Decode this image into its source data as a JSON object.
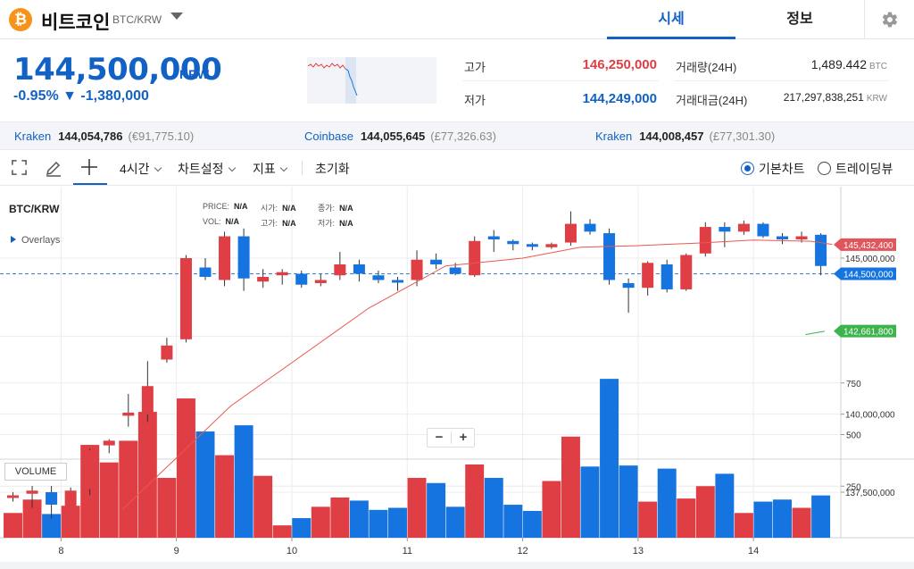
{
  "header": {
    "coin_symbol": "₿",
    "coin_name": "비트코인",
    "pair": "BTC/KRW",
    "tabs": [
      {
        "label": "시세",
        "active": true
      },
      {
        "label": "정보",
        "active": false
      }
    ],
    "settings_icon": "gear-icon"
  },
  "ticker": {
    "price": "144,500,000",
    "unit": "KRW",
    "change": "-0.95% ▼ -1,380,000",
    "high_label": "고가",
    "high_value": "146,250,000",
    "low_label": "저가",
    "low_value": "144,249,000",
    "volume_label": "거래량(24H)",
    "volume_value": "1,489.442",
    "volume_unit": "BTC",
    "amount_label": "거래대금(24H)",
    "amount_value": "217,297,838,251",
    "amount_unit": "KRW"
  },
  "exchanges": [
    {
      "name": "Kraken",
      "price": "144,054,786",
      "sub": "(€91,775.10)"
    },
    {
      "name": "Coinbase",
      "price": "144,055,645",
      "sub": "(£77,326.63)"
    },
    {
      "name": "Kraken",
      "price": "144,008,457",
      "sub": "(£77,301.30)"
    }
  ],
  "toolbar": {
    "interval": "4시간",
    "chart_settings": "차트설정",
    "indicators": "지표",
    "reset": "초기화",
    "radio_basic": "기본차트",
    "radio_tv": "트레이딩뷰"
  },
  "chart": {
    "title": "BTC/KRW",
    "overlays": "Overlays",
    "legend": {
      "price_label": "PRICE:",
      "price_val": "N/A",
      "open_label": "시가:",
      "open_val": "N/A",
      "close_label": "종가:",
      "close_val": "N/A",
      "vol_label": "VOL:",
      "vol_val": "N/A",
      "high_label": "고가:",
      "high_val": "N/A",
      "low_label": "저가:",
      "low_val": "N/A"
    },
    "volume_label": "VOLUME",
    "zoom_minus": "−",
    "zoom_plus": "+"
  },
  "chart_data": {
    "type": "candlestick",
    "up_color": "#e03e45",
    "down_color": "#1574e0",
    "ma_color": "#e8584f",
    "price_axis_ticks": [
      {
        "value": 145000000,
        "label": "145,000,000"
      },
      {
        "value": 140000000,
        "label": "140,000,000"
      },
      {
        "value": 137500000,
        "label": "137,500,000"
      }
    ],
    "price_tags": [
      {
        "value": 145432400,
        "label": "145,432,400",
        "color": "#e0565c"
      },
      {
        "value": 144500000,
        "label": "144,500,000",
        "color": "#1574e0"
      },
      {
        "value": 142661800,
        "label": "142,661,800",
        "color": "#3cb44b"
      }
    ],
    "volume_axis_ticks": [
      {
        "value": 750,
        "label": "750"
      },
      {
        "value": 500,
        "label": "500"
      },
      {
        "value": 250,
        "label": "250"
      }
    ],
    "x_tick_labels": [
      "8",
      "9",
      "10",
      "11",
      "12",
      "13",
      "14"
    ],
    "x_tick_candle_index": [
      2.5,
      8.5,
      14.5,
      20.5,
      26.5,
      32.5,
      38.5
    ],
    "candles": [
      {
        "o": 137350000,
        "c": 137400000,
        "h": 137500000,
        "l": 137200000,
        "v": 120
      },
      {
        "o": 137450000,
        "c": 137550000,
        "h": 137700000,
        "l": 137000000,
        "v": 185
      },
      {
        "o": 137500000,
        "c": 137100000,
        "h": 137700000,
        "l": 136650000,
        "v": 115
      },
      {
        "o": 136950000,
        "c": 137550000,
        "h": 137650000,
        "l": 136950000,
        "v": 155
      },
      {
        "o": 137600000,
        "c": 138850000,
        "h": 138900000,
        "l": 137400000,
        "v": 450
      },
      {
        "o": 139000000,
        "c": 139150000,
        "h": 139200000,
        "l": 138750000,
        "v": 365
      },
      {
        "o": 139950000,
        "c": 140050000,
        "h": 140650000,
        "l": 139600000,
        "v": 470
      },
      {
        "o": 140000000,
        "c": 140900000,
        "h": 141700000,
        "l": 139750000,
        "v": 610
      },
      {
        "o": 141750000,
        "c": 142200000,
        "h": 142450000,
        "l": 141650000,
        "v": 290
      },
      {
        "o": 142400000,
        "c": 145000000,
        "h": 145100000,
        "l": 142300000,
        "v": 675
      },
      {
        "o": 144700000,
        "c": 144400000,
        "h": 145000000,
        "l": 144300000,
        "v": 515
      },
      {
        "o": 144300000,
        "c": 145700000,
        "h": 145850000,
        "l": 144100000,
        "v": 400
      },
      {
        "o": 145700000,
        "c": 144350000,
        "h": 145950000,
        "l": 143950000,
        "v": 545
      },
      {
        "o": 144250000,
        "c": 144400000,
        "h": 144650000,
        "l": 144050000,
        "v": 300
      },
      {
        "o": 144450000,
        "c": 144550000,
        "h": 144650000,
        "l": 144150000,
        "v": 60
      },
      {
        "o": 144500000,
        "c": 144150000,
        "h": 144600000,
        "l": 144050000,
        "v": 95
      },
      {
        "o": 144200000,
        "c": 144300000,
        "h": 144500000,
        "l": 144100000,
        "v": 150
      },
      {
        "o": 144450000,
        "c": 144800000,
        "h": 145200000,
        "l": 144300000,
        "v": 195
      },
      {
        "o": 144800000,
        "c": 144500000,
        "h": 144950000,
        "l": 144250000,
        "v": 180
      },
      {
        "o": 144450000,
        "c": 144300000,
        "h": 144600000,
        "l": 144200000,
        "v": 135
      },
      {
        "o": 144300000,
        "c": 144250000,
        "h": 144400000,
        "l": 143950000,
        "v": 145
      },
      {
        "o": 144300000,
        "c": 144950000,
        "h": 145250000,
        "l": 144100000,
        "v": 290
      },
      {
        "o": 144950000,
        "c": 144800000,
        "h": 145150000,
        "l": 144650000,
        "v": 265
      },
      {
        "o": 144700000,
        "c": 144500000,
        "h": 144850000,
        "l": 144450000,
        "v": 150
      },
      {
        "o": 144450000,
        "c": 145550000,
        "h": 145700000,
        "l": 144400000,
        "v": 355
      },
      {
        "o": 145700000,
        "c": 145600000,
        "h": 145900000,
        "l": 145200000,
        "v": 290
      },
      {
        "o": 145550000,
        "c": 145450000,
        "h": 145600000,
        "l": 145250000,
        "v": 160
      },
      {
        "o": 145450000,
        "c": 145400000,
        "h": 145500000,
        "l": 145250000,
        "v": 130
      },
      {
        "o": 145350000,
        "c": 145450000,
        "h": 145500000,
        "l": 145300000,
        "v": 275
      },
      {
        "o": 145500000,
        "c": 146100000,
        "h": 146500000,
        "l": 145400000,
        "v": 490
      },
      {
        "o": 146100000,
        "c": 145850000,
        "h": 146250000,
        "l": 145750000,
        "v": 345
      },
      {
        "o": 145800000,
        "c": 144300000,
        "h": 145950000,
        "l": 144150000,
        "v": 770
      },
      {
        "o": 144200000,
        "c": 144050000,
        "h": 144350000,
        "l": 143250000,
        "v": 350
      },
      {
        "o": 144050000,
        "c": 144850000,
        "h": 144900000,
        "l": 143800000,
        "v": 175
      },
      {
        "o": 144800000,
        "c": 144000000,
        "h": 144950000,
        "l": 143900000,
        "v": 335
      },
      {
        "o": 144000000,
        "c": 145100000,
        "h": 145150000,
        "l": 143950000,
        "v": 190
      },
      {
        "o": 145150000,
        "c": 146000000,
        "h": 146150000,
        "l": 145050000,
        "v": 250
      },
      {
        "o": 146000000,
        "c": 145850000,
        "h": 146150000,
        "l": 145350000,
        "v": 310
      },
      {
        "o": 145850000,
        "c": 146100000,
        "h": 146200000,
        "l": 145750000,
        "v": 120
      },
      {
        "o": 146100000,
        "c": 145700000,
        "h": 146150000,
        "l": 145650000,
        "v": 175
      },
      {
        "o": 145700000,
        "c": 145600000,
        "h": 145800000,
        "l": 145450000,
        "v": 185
      },
      {
        "o": 145600000,
        "c": 145700000,
        "h": 145850000,
        "l": 145500000,
        "v": 145
      },
      {
        "o": 145750000,
        "c": 144750000,
        "h": 145800000,
        "l": 144450000,
        "v": 205
      }
    ],
    "moving_average": [
      {
        "i": 5.7,
        "v": 136950000
      },
      {
        "i": 8.5,
        "v": 138600000
      },
      {
        "i": 11.3,
        "v": 140250000
      },
      {
        "i": 14.5,
        "v": 141650000
      },
      {
        "i": 18.5,
        "v": 143400000
      },
      {
        "i": 22.5,
        "v": 144750000
      },
      {
        "i": 26.5,
        "v": 145000000
      },
      {
        "i": 29.5,
        "v": 145350000
      },
      {
        "i": 32.5,
        "v": 145400000
      },
      {
        "i": 35.5,
        "v": 145480000
      },
      {
        "i": 38.5,
        "v": 145580000
      },
      {
        "i": 41.5,
        "v": 145540000
      },
      {
        "i": 42.6,
        "v": 145440000
      }
    ],
    "ma_projection": [
      {
        "i": 41.2,
        "v": 142550000
      },
      {
        "i": 42.2,
        "v": 142661800
      }
    ],
    "current_price": 144500000
  }
}
